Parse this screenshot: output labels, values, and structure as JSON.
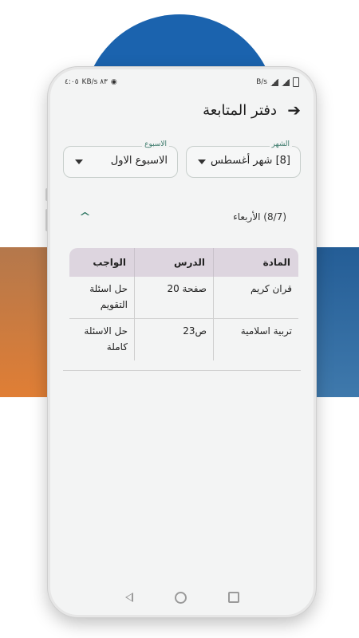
{
  "status_bar": {
    "time": "٤:٠٥",
    "left_indicators": "KB/s ٨٣",
    "right_indicators": "B/s"
  },
  "header": {
    "title": "دفتر المتابعة",
    "back_icon": "arrow-right-icon"
  },
  "filters": {
    "month": {
      "label": "الشهر",
      "value": "[8] شهر أغسطس"
    },
    "week": {
      "label": "الاسبوع",
      "value": "الاسبوع الاول"
    }
  },
  "day": {
    "label": "(8/7) الأربعاء",
    "expanded": true
  },
  "table": {
    "headers": [
      "المادة",
      "الدرس",
      "الواجب"
    ],
    "rows": [
      [
        "قران كريم",
        "صفحة 20",
        "حل اسئلة التقويم"
      ],
      [
        "تربية اسلامية",
        "ص23",
        "حل الاسئلة كاملة"
      ]
    ]
  },
  "colors": {
    "accent": "#1f6d57",
    "table_header": "#ddd5df",
    "background_circle": "#1b63ae",
    "band_left": "#e07e35",
    "band_right": "#3f79ac"
  }
}
